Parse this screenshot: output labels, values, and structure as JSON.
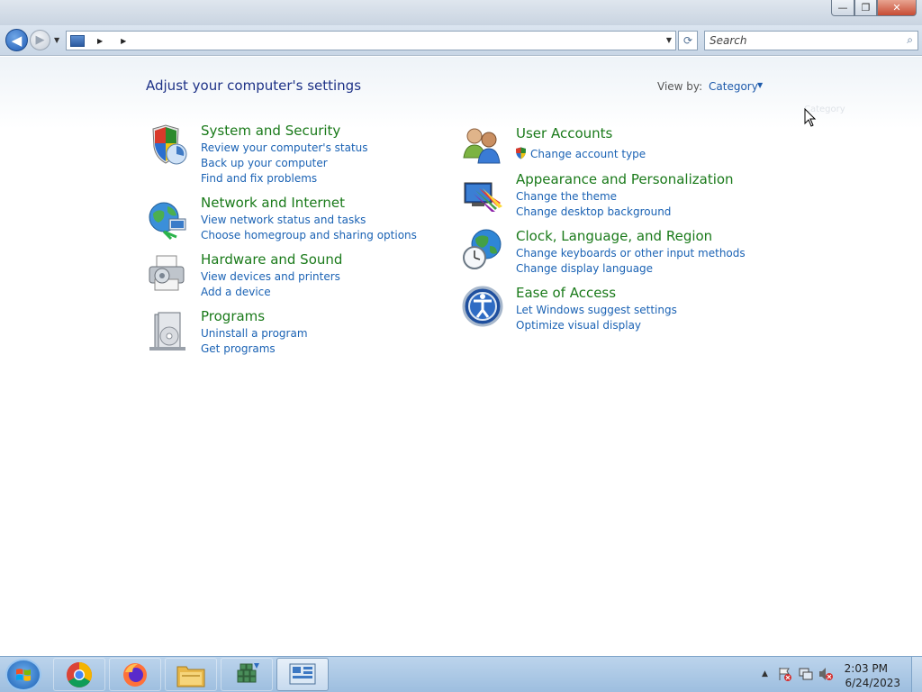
{
  "window": {
    "minimize": "—",
    "maximize": "❐",
    "close": "✕"
  },
  "nav": {
    "address_placeholder": "",
    "search_placeholder": "Search"
  },
  "main": {
    "heading": "Adjust your computer's settings",
    "view_by_label": "View by:",
    "view_by_value": "Category",
    "tooltip_ghost": "Category"
  },
  "categories": [
    {
      "title": "System and Security",
      "links": [
        "Review your computer's status",
        "Back up your computer",
        "Find and fix problems"
      ]
    },
    {
      "title": "Network and Internet",
      "links": [
        "View network status and tasks",
        "Choose homegroup and sharing options"
      ]
    },
    {
      "title": "Hardware and Sound",
      "links": [
        "View devices and printers",
        "Add a device"
      ]
    },
    {
      "title": "Programs",
      "links": [
        "Uninstall a program",
        "Get programs"
      ]
    },
    {
      "title": "User Accounts",
      "links": [
        "Change account type"
      ]
    },
    {
      "title": "Appearance and Personalization",
      "links": [
        "Change the theme",
        "Change desktop background"
      ]
    },
    {
      "title": "Clock, Language, and Region",
      "links": [
        "Change keyboards or other input methods",
        "Change display language"
      ]
    },
    {
      "title": "Ease of Access",
      "links": [
        "Let Windows suggest settings",
        "Optimize visual display"
      ]
    }
  ],
  "taskbar": {
    "apps": [
      "chrome-icon",
      "firefox-icon",
      "file-explorer-icon",
      "app-grid-icon",
      "control-panel-icon"
    ],
    "time": "2:03 PM",
    "date": "6/24/2023"
  }
}
